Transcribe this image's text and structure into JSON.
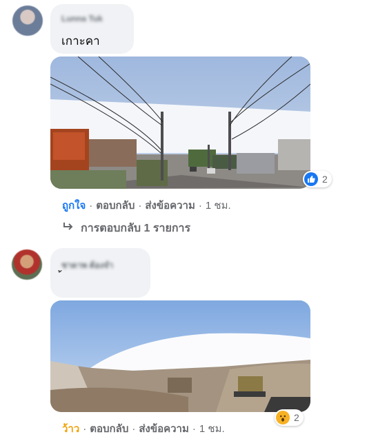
{
  "comments": [
    {
      "author": "Lunna Tuk",
      "text": "เกาะคา",
      "reaction_count": "2",
      "actions": {
        "react": "ถูกใจ",
        "reply": "ตอบกลับ",
        "message": "ส่งข้อความ",
        "time": "1 ชม."
      },
      "replies_label": "การตอบกลับ 1 รายการ"
    },
    {
      "author": "ชาดาพ ต้องจำ",
      "text": "้",
      "reaction_count": "2",
      "actions": {
        "react": "ว้าว",
        "reply": "ตอบกลับ",
        "message": "ส่งข้อความ",
        "time": "1 ชม."
      }
    }
  ],
  "icons": {
    "like": "like-icon",
    "wow": "wow-icon",
    "reply_arrow": "reply-arrow-icon"
  },
  "colors": {
    "link_blue": "#1877f2",
    "wow_orange": "#f0a30a",
    "bubble_gray": "#f0f2f5",
    "meta_gray": "#65676b"
  }
}
